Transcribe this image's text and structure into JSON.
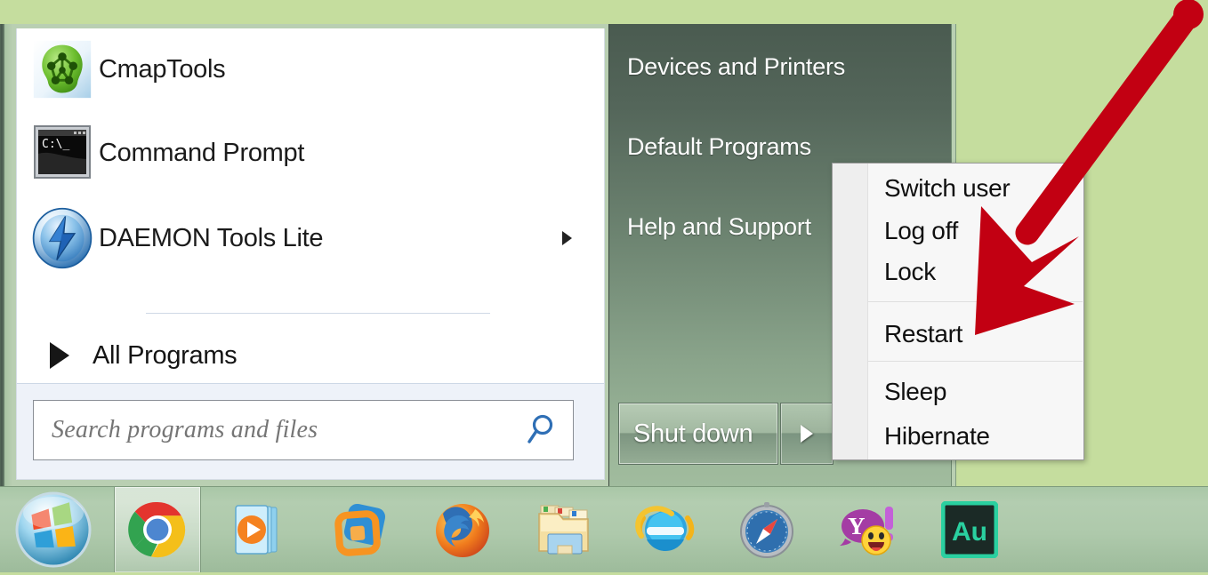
{
  "desktop": {
    "background_color": "#c5dd9e"
  },
  "start_menu": {
    "programs": [
      {
        "label": "CmapTools",
        "icon": "cmaptools-icon",
        "has_submenu": false
      },
      {
        "label": "Command Prompt",
        "icon": "command-prompt-icon",
        "has_submenu": false
      },
      {
        "label": "DAEMON Tools Lite",
        "icon": "daemon-tools-icon",
        "has_submenu": true
      }
    ],
    "all_programs_label": "All Programs",
    "search": {
      "placeholder": "Search programs and files",
      "value": "",
      "icon": "search-icon"
    },
    "right_items": [
      {
        "label": "Devices and Printers"
      },
      {
        "label": "Default Programs"
      },
      {
        "label": "Help and Support"
      }
    ],
    "shutdown": {
      "label": "Shut down",
      "arrow_icon": "chevron-right-icon"
    }
  },
  "power_menu": {
    "items": [
      {
        "label": "Switch user",
        "group": 1
      },
      {
        "label": "Log off",
        "group": 1
      },
      {
        "label": "Lock",
        "group": 1
      },
      {
        "label": "Restart",
        "group": 2
      },
      {
        "label": "Sleep",
        "group": 3
      },
      {
        "label": "Hibernate",
        "group": 3
      }
    ],
    "highlighted_item": "Restart"
  },
  "annotation": {
    "type": "arrow",
    "color": "#c20012",
    "points_to": "Restart"
  },
  "taskbar": {
    "start_button": {
      "name": "start-orb",
      "label": "Start"
    },
    "buttons": [
      {
        "name": "google-chrome-icon",
        "label": "Google Chrome",
        "active": true
      },
      {
        "name": "windows-media-player-icon",
        "label": "Windows Media Player",
        "active": false
      },
      {
        "name": "vmware-workstation-icon",
        "label": "VMware Workstation",
        "active": false
      },
      {
        "name": "mozilla-firefox-icon",
        "label": "Mozilla Firefox",
        "active": false
      },
      {
        "name": "windows-explorer-icon",
        "label": "Windows Explorer",
        "active": false
      },
      {
        "name": "internet-explorer-icon",
        "label": "Internet Explorer",
        "active": false
      },
      {
        "name": "safari-icon",
        "label": "Safari",
        "active": false
      },
      {
        "name": "yahoo-messenger-icon",
        "label": "Yahoo! Messenger",
        "active": false
      },
      {
        "name": "adobe-audition-icon",
        "label": "Adobe Audition",
        "active": false
      }
    ]
  }
}
